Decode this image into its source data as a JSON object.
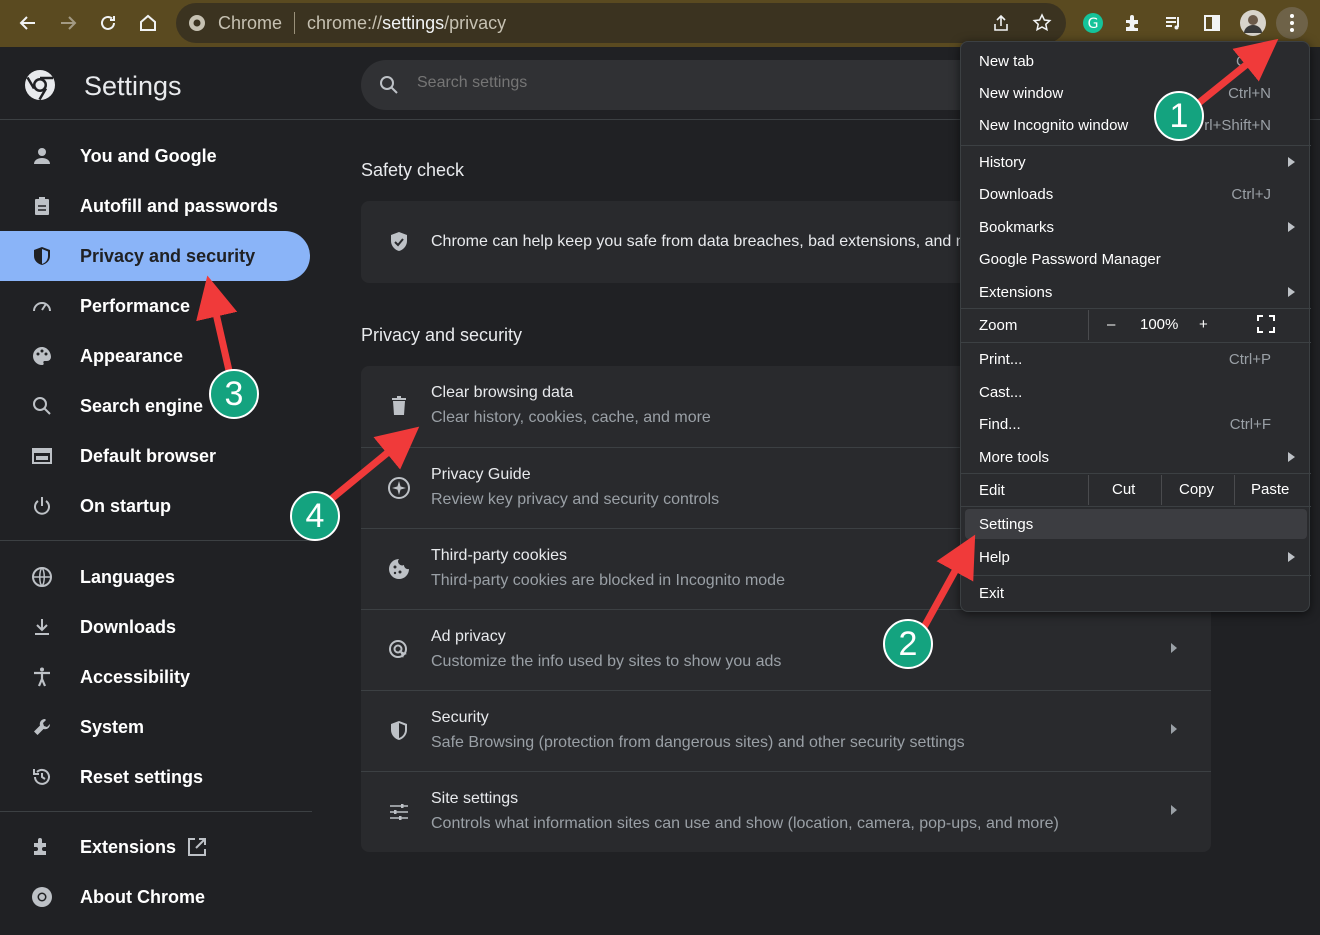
{
  "browser": {
    "site_label": "Chrome",
    "url_scheme": "chrome://",
    "url_host": "settings",
    "url_path": "/privacy"
  },
  "header": {
    "title": "Settings",
    "search_placeholder": "Search settings"
  },
  "sidebar": {
    "items": [
      {
        "label": "You and Google"
      },
      {
        "label": "Autofill and passwords"
      },
      {
        "label": "Privacy and security"
      },
      {
        "label": "Performance"
      },
      {
        "label": "Appearance"
      },
      {
        "label": "Search engine"
      },
      {
        "label": "Default browser"
      },
      {
        "label": "On startup"
      },
      {
        "label": "Languages"
      },
      {
        "label": "Downloads"
      },
      {
        "label": "Accessibility"
      },
      {
        "label": "System"
      },
      {
        "label": "Reset settings"
      },
      {
        "label": "Extensions"
      },
      {
        "label": "About Chrome"
      }
    ]
  },
  "main": {
    "safety_check": {
      "title": "Safety check",
      "text": "Chrome can help keep you safe from data breaches, bad extensions, and m"
    },
    "privacy": {
      "title": "Privacy and security",
      "rows": [
        {
          "title": "Clear browsing data",
          "sub": "Clear history, cookies, cache, and more"
        },
        {
          "title": "Privacy Guide",
          "sub": "Review key privacy and security controls"
        },
        {
          "title": "Third-party cookies",
          "sub": "Third-party cookies are blocked in Incognito mode"
        },
        {
          "title": "Ad privacy",
          "sub": "Customize the info used by sites to show you ads"
        },
        {
          "title": "Security",
          "sub": "Safe Browsing (protection from dangerous sites) and other security settings"
        },
        {
          "title": "Site settings",
          "sub": "Controls what information sites can use and show (location, camera, pop-ups, and more)"
        }
      ]
    }
  },
  "menu": {
    "items": {
      "new_tab": {
        "label": "New tab",
        "shortcut": "Ct"
      },
      "new_window": {
        "label": "New window",
        "shortcut": "Ctrl+N"
      },
      "incognito": {
        "label": "New Incognito window",
        "shortcut": "rl+Shift+N"
      },
      "history": {
        "label": "History"
      },
      "downloads": {
        "label": "Downloads",
        "shortcut": "Ctrl+J"
      },
      "bookmarks": {
        "label": "Bookmarks"
      },
      "password_manager": {
        "label": "Google Password Manager"
      },
      "extensions": {
        "label": "Extensions"
      },
      "zoom": {
        "label": "Zoom",
        "minus": "–",
        "value": "100%",
        "plus": "+"
      },
      "print": {
        "label": "Print...",
        "shortcut": "Ctrl+P"
      },
      "cast": {
        "label": "Cast..."
      },
      "find": {
        "label": "Find...",
        "shortcut": "Ctrl+F"
      },
      "more_tools": {
        "label": "More tools"
      },
      "edit": {
        "label": "Edit",
        "cut": "Cut",
        "copy": "Copy",
        "paste": "Paste"
      },
      "settings": {
        "label": "Settings"
      },
      "help": {
        "label": "Help"
      },
      "exit": {
        "label": "Exit"
      }
    }
  },
  "annotations": {
    "badge_1": "1",
    "badge_2": "2",
    "badge_3": "3",
    "badge_4": "4",
    "arrow_color": "#f03a3a",
    "badge_color": "#14a37f"
  }
}
